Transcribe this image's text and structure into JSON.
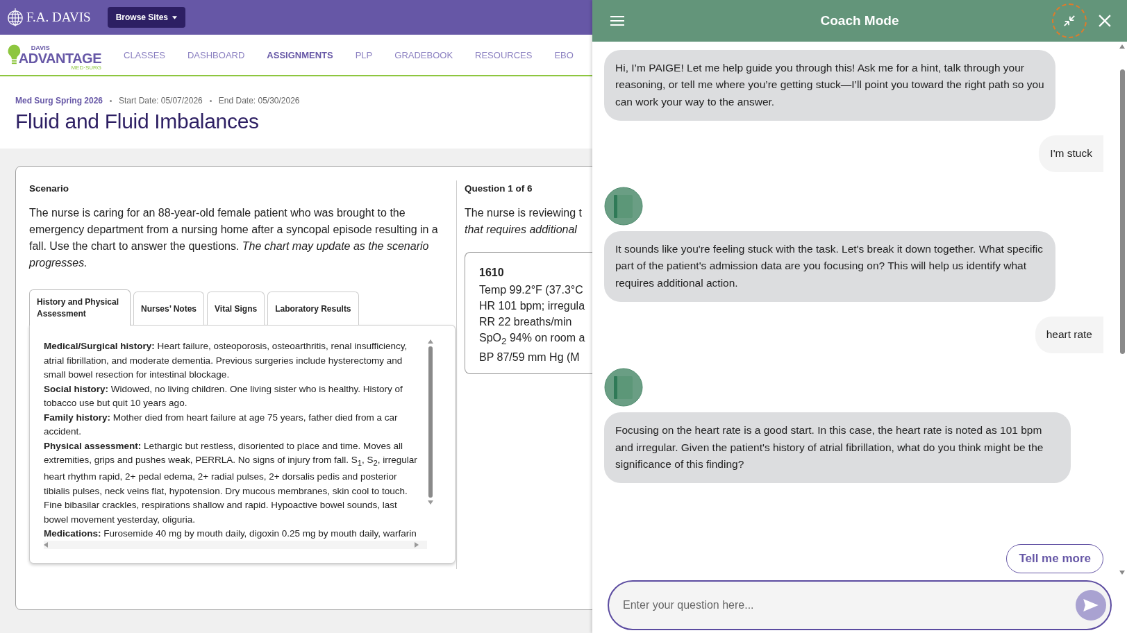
{
  "topbar": {
    "brand": "F.A. DAVIS",
    "browse_button": "Browse Sites"
  },
  "nav": {
    "logo_top": "DAVIS",
    "logo_main": "ADVANTAGE",
    "logo_sub": "MED·SURG",
    "items": [
      {
        "label": "CLASSES",
        "selected": false
      },
      {
        "label": "DASHBOARD",
        "selected": false
      },
      {
        "label": "ASSIGNMENTS",
        "selected": true
      },
      {
        "label": "PLP",
        "selected": false
      },
      {
        "label": "GRADEBOOK",
        "selected": false
      },
      {
        "label": "RESOURCES",
        "selected": false
      },
      {
        "label": "EBO",
        "selected": false
      }
    ]
  },
  "breadcrumb": {
    "course": "Med Surg Spring 2026",
    "start": "Start Date: 05/07/2026",
    "end": "End Date: 05/30/2026"
  },
  "title": "Fluid and Fluid Imbalances",
  "scenario": {
    "heading": "Scenario",
    "text": "The nurse is caring for an 88-year-old female patient who was brought to the emergency department from a nursing home after a syncopal episode resulting in a fall. Use the chart to answer the questions. *The chart may update as the scenario progresses.*",
    "tabs": [
      {
        "label": "History and Physical Assessment",
        "selected": true
      },
      {
        "label": "Nurses’ Notes",
        "selected": false
      },
      {
        "label": "Vital Signs",
        "selected": false
      },
      {
        "label": "Laboratory Results",
        "selected": false
      }
    ],
    "entries": [
      {
        "label": "Medical/Surgical history:",
        "text": "Heart failure, osteoporosis, osteoarthritis, renal insufficiency, atrial fibrillation, and moderate dementia. Previous surgeries include hysterectomy and small bowel resection for intestinal blockage."
      },
      {
        "label": "Social history:",
        "text": "Widowed, no living children. One living sister who is healthy. History of tobacco use but quit 10 years ago."
      },
      {
        "label": "Family history:",
        "text": "Mother died from heart failure at age 75 years, father died from a car accident."
      },
      {
        "label": "Physical assessment:",
        "text": "Lethargic but restless, disoriented to place and time. Moves all extremities, grips and pushes weak, PERRLA. No signs of injury from fall. S$_{1}$, S$_{2}$, irregular heart rhythm rapid, 2+ pedal edema, 2+ radial pulses, 2+ dorsalis pedis and posterior tibialis pulses, neck veins flat, hypotension. Dry mucous membranes, skin cool to touch. Fine bibasilar crackles, respirations shallow and rapid. Hypoactive bowel sounds, last bowel movement yesterday, oliguria."
      },
      {
        "label": "Medications:",
        "text": "Furosemide 40 mg by mouth daily, digoxin 0.25 mg by mouth daily, warfarin"
      }
    ]
  },
  "question": {
    "heading": "Question 1 of 6",
    "lines": [
      {
        "kind": "plain",
        "text": "The nurse is reviewing t"
      },
      {
        "kind": "italic",
        "text": "that requires additional"
      }
    ],
    "vitals": {
      "time": "1610",
      "lines": [
        "Temp 99.2°F (37.3°C",
        "HR 101 bpm; irregula",
        "RR 22 breaths/min",
        "SpO$_{2}$ 94% on room a",
        "BP 87/59 mm Hg (M"
      ]
    }
  },
  "coach": {
    "title": "Coach Mode",
    "messages": [
      {
        "kind": "bot",
        "avatar": false,
        "text": "Hi, I’m PAIGE! Let me help guide you through this! Ask me for a hint, talk through your reasoning, or tell me where you’re getting stuck—I’ll point you toward the right path so you can work your way to the answer."
      },
      {
        "kind": "user",
        "avatar": false,
        "text": "I'm stuck"
      },
      {
        "kind": "bot",
        "avatar": true,
        "text": "It sounds like you're feeling stuck with the task. Let's break it down together. What specific part of the patient's admission data are you focusing on? This will help us identify what requires additional action."
      },
      {
        "kind": "user",
        "avatar": false,
        "text": "heart rate"
      },
      {
        "kind": "bot",
        "avatar": true,
        "text": "Focusing on the heart rate is a good start. In this case, the heart rate is noted as 101 bpm and irregular. Given the patient's history of atrial fibrillation, what do you think might be the significance of this finding?"
      }
    ],
    "suggestion": "Tell me more",
    "input": {
      "placeholder": "Enter your question here..."
    }
  }
}
